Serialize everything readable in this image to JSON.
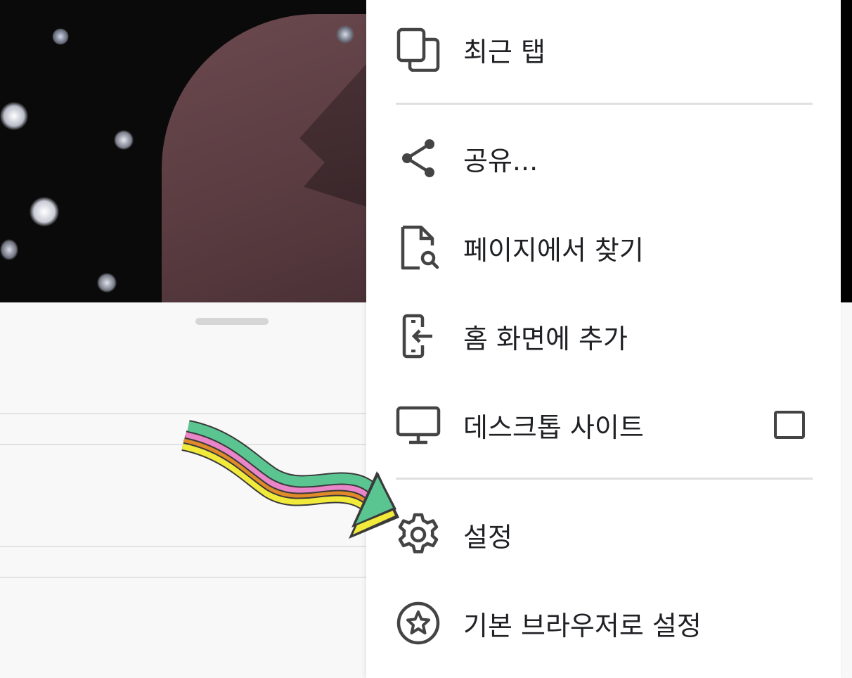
{
  "menu": {
    "items": [
      {
        "label": "최근 탭",
        "icon": "recent-tabs-icon"
      },
      {
        "label": "공유...",
        "icon": "share-icon"
      },
      {
        "label": "페이지에서 찾기",
        "icon": "find-in-page-icon"
      },
      {
        "label": "홈 화면에 추가",
        "icon": "add-to-home-screen-icon"
      },
      {
        "label": "데스크톱 사이트",
        "icon": "desktop-icon",
        "checked": false
      },
      {
        "label": "설정",
        "icon": "settings-icon"
      },
      {
        "label": "기본 브라우저로 설정",
        "icon": "star-circle-icon"
      }
    ]
  },
  "colors": {
    "icon": "#444444",
    "text": "#202124",
    "divider": "#e0e0e0",
    "arrow_green": "#5bc591",
    "arrow_pink": "#e985c8",
    "arrow_orange": "#e08a2a",
    "arrow_yellow": "#f2ea3a"
  }
}
